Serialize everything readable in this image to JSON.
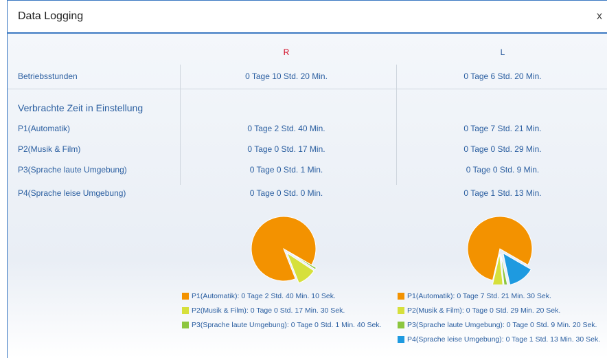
{
  "window": {
    "title": "Data Logging",
    "close_glyph": "x"
  },
  "columns": {
    "right": "R",
    "left": "L"
  },
  "operating_hours": {
    "label": "Betriebsstunden",
    "right": "0 Tage 10 Std. 20 Min.",
    "left": "0 Tage 6 Std. 20 Min."
  },
  "time_in_setting": {
    "label": "Verbrachte Zeit in Einstellung",
    "rows": [
      {
        "label": "P1(Automatik)",
        "right": "0 Tage 2 Std. 40 Min.",
        "left": "0 Tage 7 Std. 21 Min."
      },
      {
        "label": "P2(Musik & Film)",
        "right": "0 Tage 0 Std. 17 Min.",
        "left": "0 Tage 0 Std. 29 Min."
      },
      {
        "label": "P3(Sprache laute Umgebung)",
        "right": "0 Tage 0 Std. 1 Min.",
        "left": "0 Tage 0 Std. 9 Min."
      },
      {
        "label": "P4(Sprache leise Umgebung)",
        "right": "0 Tage 0 Std. 0 Min.",
        "left": "0 Tage 1 Std. 13 Min."
      }
    ]
  },
  "colors": {
    "p1": "#f39200",
    "p2": "#d6e03c",
    "p3": "#8cc63f",
    "p4": "#1e9ae0"
  },
  "chart_data": [
    {
      "type": "pie",
      "name": "R",
      "slices": [
        {
          "label": "P1(Automatik): 0 Tage 2 Std. 40 Min. 10 Sek.",
          "value": 9610,
          "color": "#f39200"
        },
        {
          "label": "P2(Musik & Film): 0 Tage 0 Std. 17 Min. 30 Sek.",
          "value": 1050,
          "color": "#d6e03c"
        },
        {
          "label": "P3(Sprache laute Umgebung): 0 Tage 0 Std. 1 Min. 40 Sek.",
          "value": 100,
          "color": "#8cc63f"
        }
      ]
    },
    {
      "type": "pie",
      "name": "L",
      "slices": [
        {
          "label": "P1(Automatik): 0 Tage 7 Std. 21 Min. 30 Sek.",
          "value": 26490,
          "color": "#f39200"
        },
        {
          "label": "P2(Musik & Film): 0 Tage 0 Std. 29 Min. 20 Sek.",
          "value": 1760,
          "color": "#d6e03c"
        },
        {
          "label": "P3(Sprache laute Umgebung): 0 Tage 0 Std. 9 Min. 20 Sek.",
          "value": 560,
          "color": "#8cc63f"
        },
        {
          "label": "P4(Sprache leise Umgebung): 0 Tage 1 Std. 13 Min. 30 Sek.",
          "value": 4410,
          "color": "#1e9ae0"
        }
      ]
    }
  ]
}
